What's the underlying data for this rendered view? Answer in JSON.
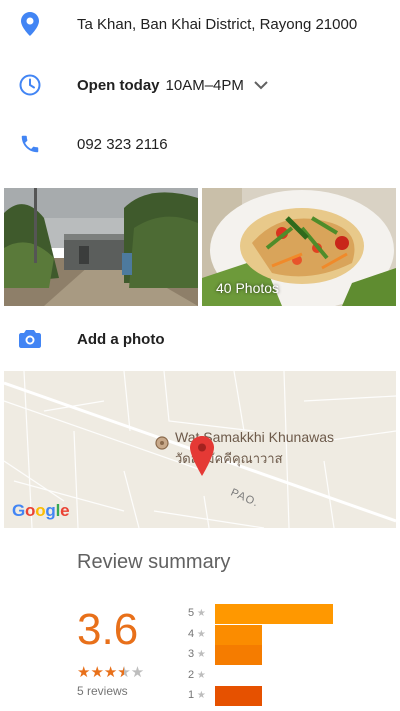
{
  "address": {
    "text": "Ta Khan, Ban Khai District, Rayong 21000",
    "icon": "location-pin-icon"
  },
  "hours": {
    "status": "Open today",
    "range": "10AM–4PM",
    "icon": "clock-icon",
    "expand_icon": "chevron-down-icon"
  },
  "phone": {
    "number": "092 323 2116",
    "icon": "phone-icon"
  },
  "photos": {
    "count_label": "40 Photos"
  },
  "add_photo": {
    "label": "Add a photo",
    "icon": "camera-icon"
  },
  "map": {
    "place_name_en": "Wat Samakkhi Khunawas",
    "place_name_th": "วัดสามัคคีคุณาวาส",
    "road_label": "PAO.",
    "logo": "Google"
  },
  "reviews": {
    "title": "Review summary",
    "average": "3.6",
    "stars_text_full": "★★★",
    "stars_text_empty": "★★",
    "count_label": "5 reviews",
    "rating_fraction": 0.72,
    "distribution": [
      {
        "label": "5",
        "fraction": 1.0,
        "color": "#ff9800"
      },
      {
        "label": "4",
        "fraction": 0.4,
        "color": "#fb8c00"
      },
      {
        "label": "3",
        "fraction": 0.4,
        "color": "#f57c00"
      },
      {
        "label": "2",
        "fraction": 0.0,
        "color": "#ef6c00"
      },
      {
        "label": "1",
        "fraction": 0.4,
        "color": "#e65100"
      }
    ]
  },
  "colors": {
    "accent_blue": "#4285f4",
    "rating_orange": "#e8701a"
  }
}
